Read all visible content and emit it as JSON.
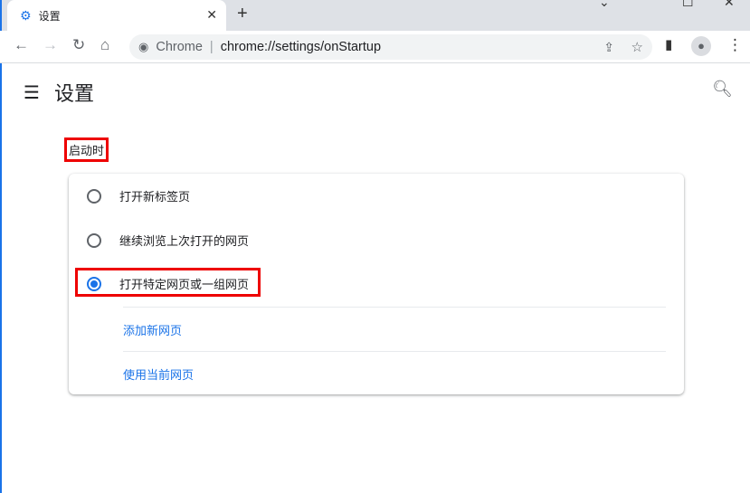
{
  "browser": {
    "tab_title": "设置",
    "omnibox": {
      "origin": "Chrome",
      "url": "chrome://settings/onStartup"
    },
    "icons": [
      "settings-gear-icon",
      "close-icon",
      "plus-icon",
      "back-icon",
      "forward-icon",
      "reload-icon",
      "home-icon",
      "share-icon",
      "star-icon",
      "sidepanel-icon",
      "profile-icon",
      "menu-dots-icon"
    ]
  },
  "page": {
    "title": "设置",
    "section_title": "启动时",
    "options": [
      {
        "label": "打开新标签页",
        "selected": false
      },
      {
        "label": "继续浏览上次打开的网页",
        "selected": false
      },
      {
        "label": "打开特定网页或一组网页",
        "selected": true
      }
    ],
    "links": [
      "添加新网页",
      "使用当前网页"
    ]
  },
  "colors": {
    "accent": "#1a73e8",
    "highlight": "#ee0000"
  }
}
